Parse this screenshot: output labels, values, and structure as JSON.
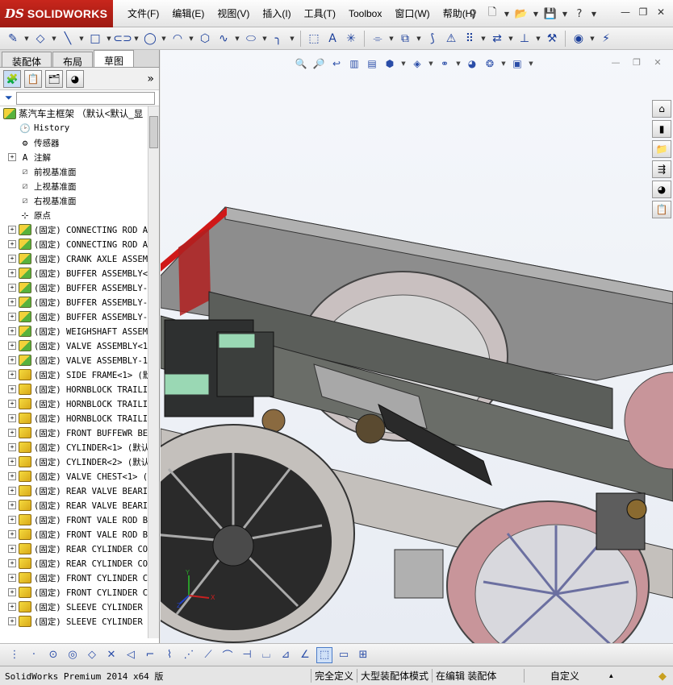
{
  "app": {
    "logo_ds": "DS",
    "logo_text": "SOLIDWORKS"
  },
  "menu": [
    {
      "label": "文件(F)"
    },
    {
      "label": "编辑(E)"
    },
    {
      "label": "视图(V)"
    },
    {
      "label": "插入(I)"
    },
    {
      "label": "工具(T)"
    },
    {
      "label": "Toolbox"
    },
    {
      "label": "窗口(W)"
    },
    {
      "label": "帮助(H)"
    }
  ],
  "quickbar_icons": [
    "pin-icon",
    "new-document-icon",
    "open-icon",
    "save-icon",
    "print-icon",
    "help-icon"
  ],
  "panel": {
    "tabs": [
      {
        "label": "装配体",
        "active": false
      },
      {
        "label": "布局",
        "active": false
      },
      {
        "label": "草图",
        "active": true
      }
    ],
    "more_glyph": "»"
  },
  "tree": {
    "root": "蒸汽车主框架 （默认<默认_显",
    "items": [
      {
        "label": "History",
        "icon": "history",
        "expander": false
      },
      {
        "label": "传感器",
        "icon": "sensor",
        "expander": false
      },
      {
        "label": "注解",
        "icon": "annotation",
        "expander": true
      },
      {
        "label": "前视基准面",
        "icon": "plane",
        "expander": false
      },
      {
        "label": "上视基准面",
        "icon": "plane",
        "expander": false
      },
      {
        "label": "右视基准面",
        "icon": "plane",
        "expander": false
      },
      {
        "label": "原点",
        "icon": "origin",
        "expander": false
      },
      {
        "label": "(固定) CONNECTING ROD A",
        "icon": "asm",
        "expander": true
      },
      {
        "label": "(固定) CONNECTING ROD A",
        "icon": "asm",
        "expander": true
      },
      {
        "label": "(固定) CRANK AXLE ASSEM",
        "icon": "asm",
        "expander": true
      },
      {
        "label": "(固定) BUFFER ASSEMBLY<",
        "icon": "asm",
        "expander": true
      },
      {
        "label": "(固定) BUFFER ASSEMBLY-",
        "icon": "asm",
        "expander": true
      },
      {
        "label": "(固定) BUFFER ASSEMBLY-",
        "icon": "asm",
        "expander": true
      },
      {
        "label": "(固定) BUFFER ASSEMBLY-",
        "icon": "asm",
        "expander": true
      },
      {
        "label": "(固定) WEIGHSHAFT ASSEM",
        "icon": "asm",
        "expander": true
      },
      {
        "label": "(固定) VALVE ASSEMBLY<1",
        "icon": "asm",
        "expander": true
      },
      {
        "label": "(固定) VALVE ASSEMBLY-1",
        "icon": "asm",
        "expander": true
      },
      {
        "label": "(固定) SIDE FRAME<1> (默",
        "icon": "part",
        "expander": true
      },
      {
        "label": "(固定) HORNBLOCK TRAILI",
        "icon": "part",
        "expander": true
      },
      {
        "label": "(固定) HORNBLOCK TRAILI",
        "icon": "part",
        "expander": true
      },
      {
        "label": "(固定) HORNBLOCK TRAILI",
        "icon": "part",
        "expander": true
      },
      {
        "label": "(固定) FRONT BUFFEWR BE",
        "icon": "part",
        "expander": true
      },
      {
        "label": "(固定) CYLINDER<1> (默认",
        "icon": "part",
        "expander": true
      },
      {
        "label": "(固定) CYLINDER<2> (默认",
        "icon": "part",
        "expander": true
      },
      {
        "label": "(固定) VALVE CHEST<1> (",
        "icon": "part",
        "expander": true
      },
      {
        "label": "(固定) REAR VALVE BEARI",
        "icon": "part",
        "expander": true
      },
      {
        "label": "(固定) REAR VALVE BEARI",
        "icon": "part",
        "expander": true
      },
      {
        "label": "(固定) FRONT VALE ROD B",
        "icon": "part",
        "expander": true
      },
      {
        "label": "(固定) FRONT VALE ROD B",
        "icon": "part",
        "expander": true
      },
      {
        "label": "(固定) REAR CYLINDER CO",
        "icon": "part",
        "expander": true
      },
      {
        "label": "(固定) REAR CYLINDER CO",
        "icon": "part",
        "expander": true
      },
      {
        "label": "(固定) FRONT CYLINDER C",
        "icon": "part",
        "expander": true
      },
      {
        "label": "(固定) FRONT CYLINDER C",
        "icon": "part",
        "expander": true
      },
      {
        "label": "(固定) SLEEVE CYLINDER",
        "icon": "part",
        "expander": true
      },
      {
        "label": "(固定) SLEEVE CYLINDER",
        "icon": "part",
        "expander": true
      }
    ]
  },
  "triad": {
    "x": "X",
    "y": "Y",
    "z": "Z"
  },
  "status": {
    "app": "SolidWorks Premium 2014 x64 版",
    "cells": [
      "完全定义",
      "大型装配体模式",
      "在编辑 装配体"
    ],
    "units": "自定义"
  },
  "colors": {
    "accent": "#c8261c",
    "frame": "#8f8f8f",
    "wheel_red": "#c8959a",
    "tree_selected": "#c8ddf6"
  }
}
